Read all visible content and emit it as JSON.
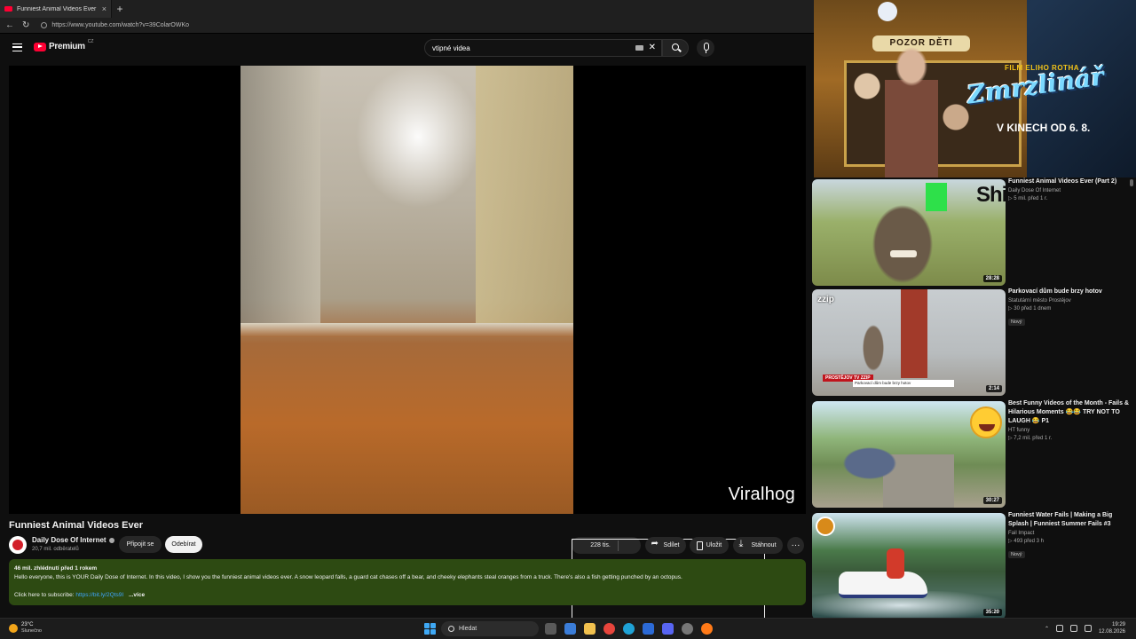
{
  "browser": {
    "tab_title": "Funniest Animal Videos Ever",
    "new_tab": "+",
    "close": "×",
    "url": "https://www.youtube.com/watch?v=39ColarOWKo"
  },
  "header": {
    "brand": "Premium",
    "country": "CZ",
    "search_value": "vtipné videa",
    "clear": "✕"
  },
  "player": {
    "watermark": "Viralhog"
  },
  "video": {
    "title": "Funniest Animal Videos Ever",
    "channel": "Daily Dose Of Internet",
    "subscribers": "20,7 mil. odběratelů",
    "join_label": "Připojit se",
    "subscribe_label": "Odebírat",
    "likes": "228 tis.",
    "share_label": "Sdílet",
    "save_label": "Uložit",
    "download_label": "Stáhnout",
    "more": "···"
  },
  "description": {
    "meta": "46 mil. zhlédnutí  před 1 rokem",
    "text": "Hello everyone, this is YOUR Daily Dose of Internet. In this video, I show you the funniest animal videos ever. A snow leopard falls, a guard cat chases off a bear, and cheeky elephants steal oranges from a truck. There's also a fish getting punched by an octopus.",
    "subscribe_prefix": "Click here to subscribe:",
    "subscribe_link": "https://bit.ly/2Qts9I",
    "more": "...více"
  },
  "ad": {
    "sign": "POZOR DĚTI",
    "kicker": "FILM ELIHO ROTHA",
    "film_title": "Zmrzlinář",
    "date": "V KINECH OD 6. 8."
  },
  "recommendations": [
    {
      "title": "Funniest Animal Videos Ever (Part 2)",
      "channel": "Daily Dose Of Internet",
      "meta": "▷ 5 mil.  před 1 r.",
      "duration": "28:28",
      "badge": "",
      "overlay": "Shi.wix"
    },
    {
      "title": "Parkovací dům bude brzy hotov",
      "channel": "Statutární město Prostějov",
      "meta": "▷ 30  před 1 dnem",
      "duration": "2:14",
      "badge": "Nový",
      "overlay": "zzip",
      "tag": "PROSTĚJOV TV ZZIP",
      "lower_third": "Parkovací dům bude brzy hotov"
    },
    {
      "title": "Best Funny Videos of the Month - Fails & Hilarious Moments 😂😂 TRY NOT TO LAUGH 😂 P1",
      "channel": "HT funny",
      "meta": "▷ 7,2 mil.  před 1 r.",
      "duration": "30:27",
      "badge": ""
    },
    {
      "title": "Funniest Water Fails | Making a Big Splash | Funniest Summer Fails #3",
      "channel": "Fail Impact",
      "meta": "▷ 493  před 3 h",
      "duration": "35:20",
      "badge": "Nový"
    }
  ],
  "taskbar": {
    "temp": "23°C",
    "condition": "Slunečno",
    "search_placeholder": "Hledat",
    "time": "19:29",
    "date": "12.08.2026"
  },
  "colors": {
    "background": "#0f0f0f",
    "description_bg": "#2d4a12",
    "brand_red": "#ff0033",
    "link": "#3ea6ff"
  }
}
